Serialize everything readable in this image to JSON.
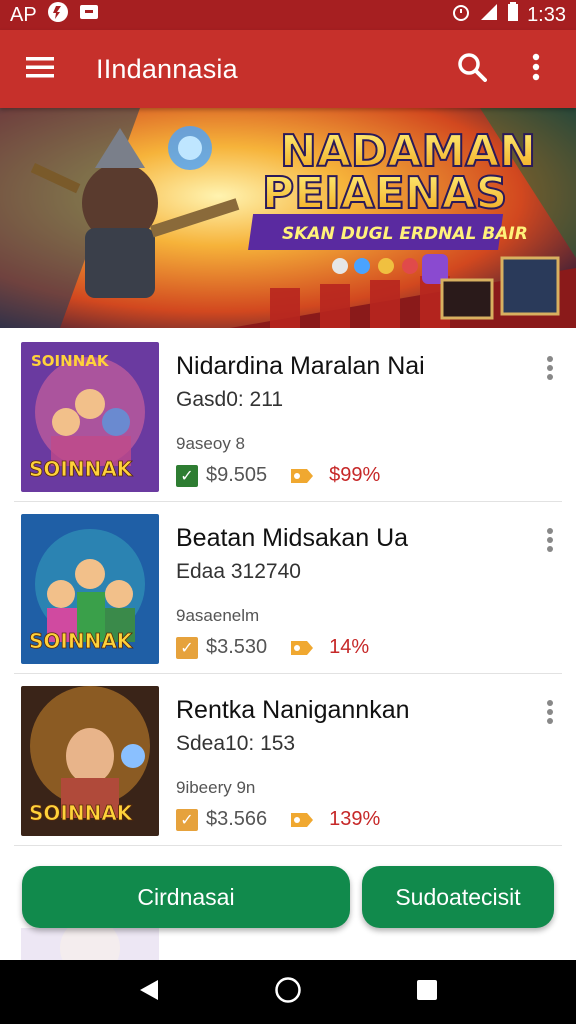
{
  "status_bar": {
    "carrier": "AP",
    "time": "1:33"
  },
  "app_bar": {
    "title": "IIndannasia",
    "menu_icon": "menu-icon",
    "search_icon": "search-icon",
    "more_icon": "more-vert-icon"
  },
  "banner": {
    "headline_1": "NADAMAN",
    "headline_2": "PEIAENAS",
    "tagline": "SKAN DUGL ERDNAL BAIR"
  },
  "items": [
    {
      "title": "Nidardina Maralan Nai",
      "subtitle": "Gasd0: 211",
      "meta": "9aseoy 8",
      "price": "$9.505",
      "discount": "$99%",
      "thumb_text": "SOINNAK",
      "check_color": "#2e7d32",
      "thumb_bg": "#6a3aa0"
    },
    {
      "title": "Beatan Midsakan Ua",
      "subtitle": "Edaa 312740",
      "meta": "9asaenelm",
      "price": "$3.530",
      "discount": "14%",
      "thumb_text": "SOINNAK",
      "check_color": "#e6a23c",
      "thumb_bg": "#1f5fa6"
    },
    {
      "title": "Rentka Nanigannkan",
      "subtitle": "Sdea10: 153",
      "meta": "9ibeery 9n",
      "price": "$3.566",
      "discount": "139%",
      "thumb_text": "SOINNAK",
      "check_color": "#e6a23c",
      "thumb_bg": "#3a2418"
    }
  ],
  "actions": {
    "primary_label": "Cirdnasai",
    "secondary_label": "Sudoatecisit"
  },
  "nav": {
    "back_icon": "back-icon",
    "home_icon": "home-icon",
    "recents_icon": "recents-icon"
  },
  "colors": {
    "status_bar": "#a61f21",
    "app_bar": "#c6302b",
    "accent_green": "#118a4c",
    "discount_red": "#c62828"
  }
}
